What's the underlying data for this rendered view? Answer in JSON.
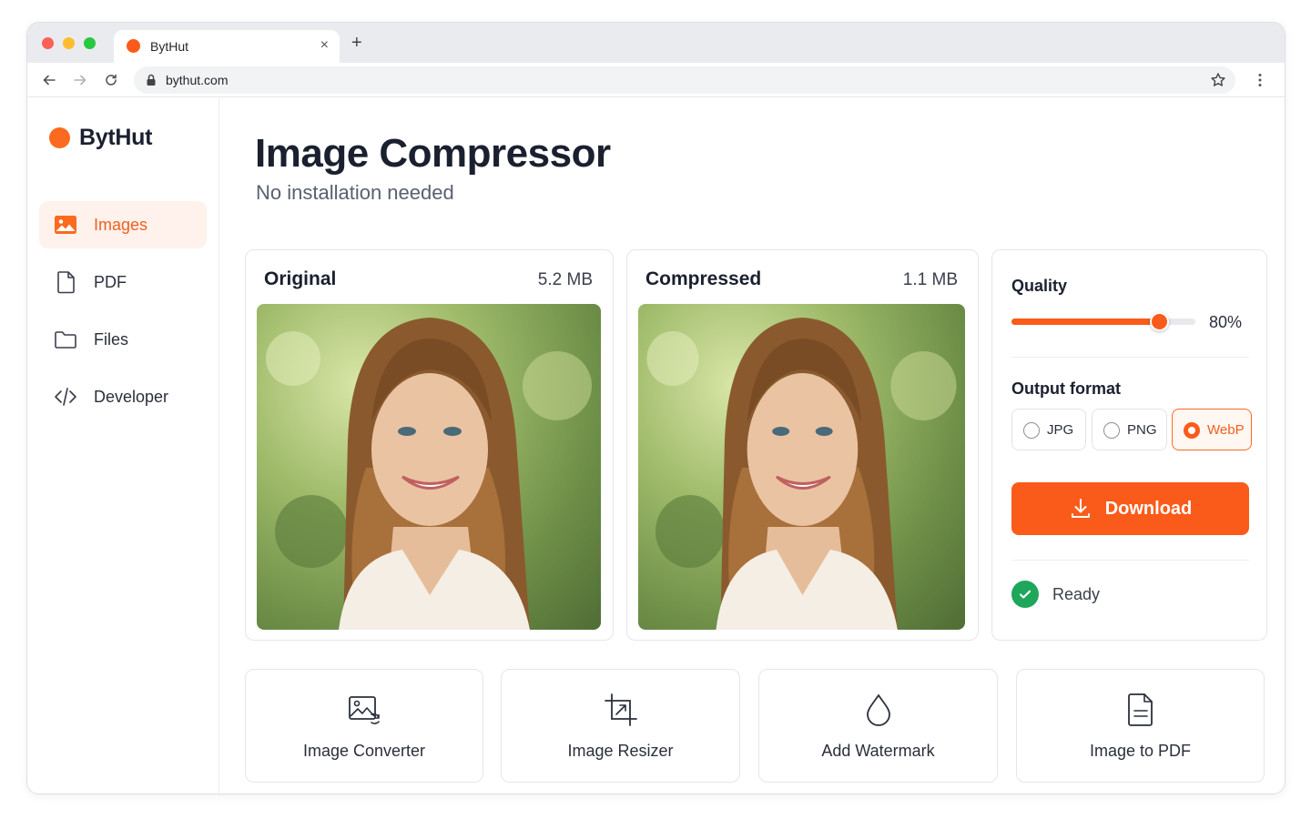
{
  "browser": {
    "tab_title": "BytHut",
    "tab_close": "×",
    "new_tab": "+",
    "url": "bythut.com"
  },
  "sidebar": {
    "brand": "BytHut",
    "items": [
      {
        "label": "Images",
        "icon": "image-icon",
        "active": true
      },
      {
        "label": "PDF",
        "icon": "document-icon",
        "active": false
      },
      {
        "label": "Files",
        "icon": "folder-icon",
        "active": false
      },
      {
        "label": "Developer",
        "icon": "code-icon",
        "active": false
      }
    ]
  },
  "main": {
    "title": "Image Compressor",
    "subtitle": "No installation needed",
    "original": {
      "title": "Original",
      "size": "5.2 MB"
    },
    "compressed": {
      "title": "Compressed",
      "size": "1.1 MB"
    },
    "settings": {
      "quality_label": "Quality",
      "quality_value": "80%",
      "quality_level": 0.8,
      "format_label": "Output format",
      "formats": [
        {
          "label": "JPG",
          "selected": false
        },
        {
          "label": "PNG",
          "selected": false
        },
        {
          "label": "WebP",
          "selected": true
        }
      ],
      "download_label": "Download",
      "status": "Ready"
    },
    "tools": [
      {
        "label": "Image Converter",
        "icon": "image-convert-icon"
      },
      {
        "label": "Image Resizer",
        "icon": "crop-resize-icon"
      },
      {
        "label": "Add Watermark",
        "icon": "droplet-icon"
      },
      {
        "label": "Image to PDF",
        "icon": "file-text-icon"
      }
    ]
  },
  "colors": {
    "accent": "#fb5b1a",
    "accent_bg": "#fff1eb",
    "success": "#1ea65a",
    "text": "#1b2030"
  }
}
